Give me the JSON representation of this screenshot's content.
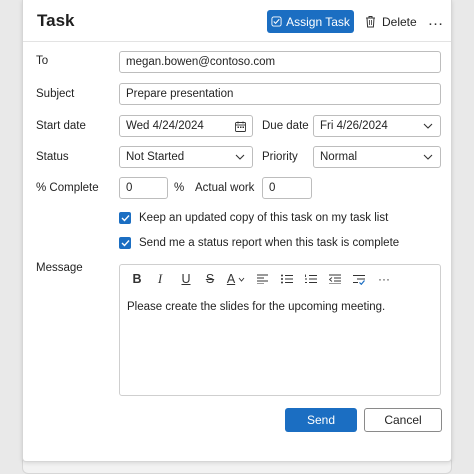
{
  "header": {
    "title": "Task",
    "assign_label": "Assign Task",
    "delete_label": "Delete",
    "more_label": "…"
  },
  "form": {
    "to_label": "To",
    "to_value": "megan.bowen@contoso.com",
    "subject_label": "Subject",
    "subject_value": "Prepare presentation",
    "start_label": "Start date",
    "start_value": "Wed 4/24/2024",
    "due_label": "Due date",
    "due_value": "Fri 4/26/2024",
    "status_label": "Status",
    "status_value": "Not Started",
    "priority_label": "Priority",
    "priority_value": "Normal",
    "complete_label": "% Complete",
    "complete_value": "0",
    "percent_sign": "%",
    "actual_label": "Actual work",
    "actual_value": "0",
    "check_keep_copy": "Keep an updated copy of this task on my task list",
    "check_status_report": "Send me a status report when this task is complete",
    "message_label": "Message"
  },
  "editor": {
    "bold": "B",
    "italic": "I",
    "underline": "U",
    "strike": "S",
    "font_color": "A",
    "more": "···",
    "body": "Please create the slides for the upcoming meeting."
  },
  "footer": {
    "send_label": "Send",
    "cancel_label": "Cancel"
  },
  "colors": {
    "accent": "#1b6ec2"
  }
}
